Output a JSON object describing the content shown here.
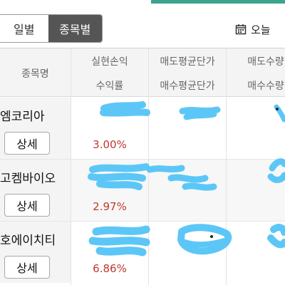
{
  "toggle": {
    "daily_label": "일별",
    "by_stock_label": "종목별",
    "active": "종목별"
  },
  "date_button": {
    "icon": "calendar-icon",
    "label": "오늘"
  },
  "table": {
    "header": {
      "name": "종목명",
      "realized_pnl": "실현손익",
      "return_rate": "수익률",
      "avg_sell_price": "매도평균단가",
      "avg_buy_price": "매수평균단가",
      "sell_qty": "매도수량",
      "buy_qty": "매수수량"
    },
    "rows": [
      {
        "name": "엠코리아",
        "detail": "상세",
        "return_rate": "3.00%"
      },
      {
        "name": "고켐바이오",
        "detail": "상세",
        "return_rate": "2.97%"
      },
      {
        "name": "호에이치티",
        "detail": "상세",
        "return_rate": "6.86%"
      }
    ]
  },
  "colors": {
    "accent": "#3aa48d",
    "toggle_active": "#555555",
    "positive_rate": "#c0392b",
    "redaction": "#4fc3f7"
  }
}
